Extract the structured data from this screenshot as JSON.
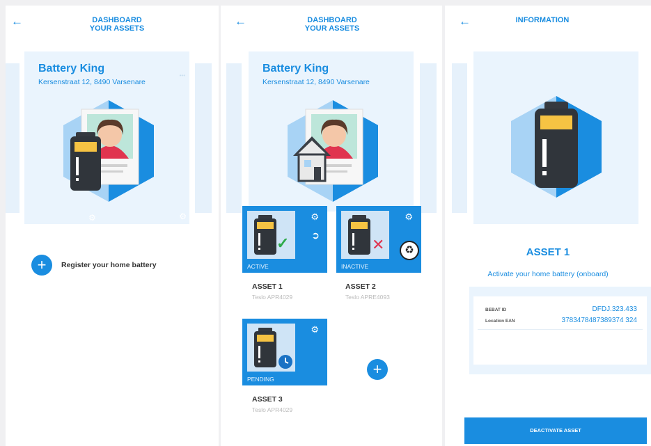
{
  "screen1": {
    "back_icon": "arrow-left-icon",
    "title_line1": "DASHBOARD",
    "title_line2": "YOUR ASSETS",
    "card": {
      "name": "Battery King",
      "address": "Kersenstraat 12, 8490 Varsenare"
    },
    "register_label": "Register your home battery",
    "register_icon": "plus-icon"
  },
  "screen2": {
    "title_line1": "DASHBOARD",
    "title_line2": "YOUR ASSETS",
    "card": {
      "name": "Battery King",
      "address": "Kersenstraat 12, 8490 Varsenare"
    },
    "assets": [
      {
        "status": "ACTIVE",
        "name": "ASSET 1",
        "model": "Teslo APR4029"
      },
      {
        "status": "INACTIVE",
        "name": "ASSET 2",
        "model": "Teslo APRE4093"
      },
      {
        "status": "PENDING",
        "name": "ASSET 3",
        "model": "Teslo APR4029"
      }
    ],
    "add_icon": "plus-icon"
  },
  "screen3": {
    "title": "INFORMATION",
    "asset_title": "ASSET 1",
    "activate_text": "Activate your home battery (onboard)",
    "fields": [
      {
        "key": "BEBAT ID",
        "value": "DFDJ.323.433"
      },
      {
        "key": "Location EAN",
        "value": "3783478487389374 324"
      }
    ],
    "deactivate_label": "DEACTIVATE ASSET"
  },
  "colors": {
    "accent": "#1a8de0",
    "panel": "#eaf4fd",
    "hex_light": "#a8d3f5",
    "hex_dark": "#1a8de0"
  }
}
